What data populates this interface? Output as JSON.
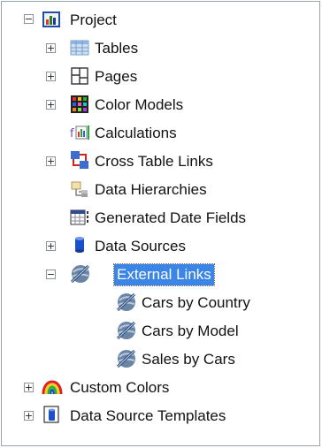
{
  "tree": {
    "project": {
      "label": "Project",
      "expander": "−",
      "icon": "project-chart-icon"
    },
    "tables": {
      "label": "Tables",
      "expander": "+",
      "icon": "table-grid-icon"
    },
    "pages": {
      "label": "Pages",
      "expander": "+",
      "icon": "page-layout-icon"
    },
    "color_models": {
      "label": "Color Models",
      "expander": "+",
      "icon": "color-palette-icon"
    },
    "calculations": {
      "label": "Calculations",
      "icon": "calculation-icon"
    },
    "cross_table_links": {
      "label": "Cross Table Links",
      "expander": "+",
      "icon": "cross-link-icon"
    },
    "data_hierarchies": {
      "label": "Data Hierarchies",
      "icon": "hierarchy-icon"
    },
    "generated_date_fields": {
      "label": "Generated Date Fields",
      "icon": "date-field-icon"
    },
    "data_sources": {
      "label": "Data Sources",
      "expander": "+",
      "icon": "database-icon"
    },
    "external_links": {
      "label": "External Links",
      "expander": "−",
      "icon": "external-link-globe-icon",
      "selected": true,
      "children": [
        {
          "label": "Cars by Country",
          "icon": "external-link-globe-icon"
        },
        {
          "label": "Cars by Model",
          "icon": "external-link-globe-icon"
        },
        {
          "label": "Sales by Cars",
          "icon": "external-link-globe-icon"
        }
      ]
    },
    "custom_colors": {
      "label": "Custom Colors",
      "expander": "+",
      "icon": "rainbow-icon"
    },
    "data_source_templates": {
      "label": "Data Source Templates",
      "expander": "+",
      "icon": "template-icon"
    }
  },
  "colors": {
    "selection": "#3b85e6",
    "selection_text": "#ffffff"
  }
}
